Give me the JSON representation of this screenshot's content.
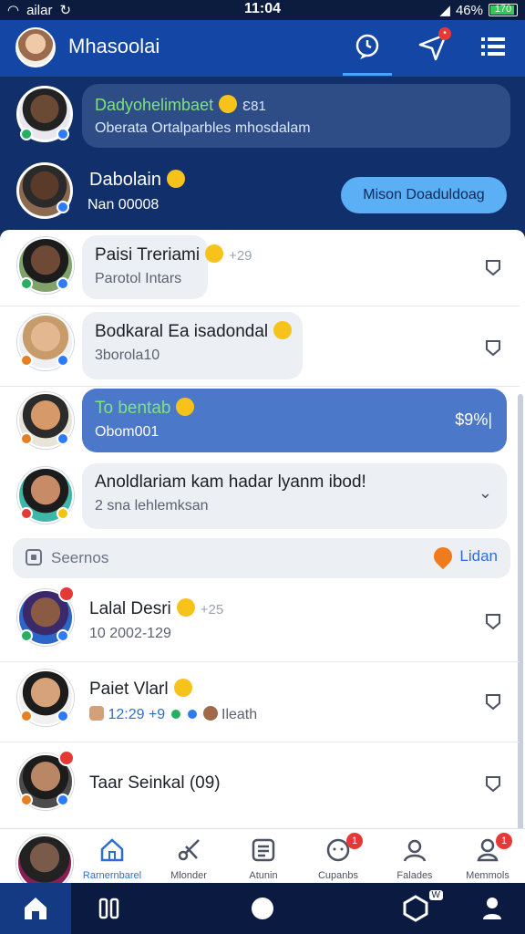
{
  "status": {
    "left": "ailar",
    "time": "11:04",
    "battery": "46%",
    "battery_box": "170"
  },
  "header": {
    "title": "Mhasoolai"
  },
  "top_rows": [
    {
      "name": "Dadyohelimbaet",
      "meta": "Ɛ81",
      "sub": "Oberata Ortalparbles mhosdalam"
    },
    {
      "name": "Dabolain",
      "sub": "Nan 00008",
      "button": "Mison Doaduldoag"
    }
  ],
  "rows": [
    {
      "name": "Paisi Treriami",
      "meta": "+29",
      "sub": "Parotol Intars"
    },
    {
      "name": "Bodkaral Ea isadondal",
      "sub": "3borola10"
    },
    {
      "name": "To bentab",
      "sub": "Obom001",
      "value": "$9%|"
    },
    {
      "name": "Anoldlariam kam hadar lyanm ibod!",
      "sub": "2 sna lehlemksan"
    },
    {
      "name": "Lalal Desri",
      "meta": "+25",
      "sub": "10 2002-129"
    },
    {
      "name": "Paiet Vlarl",
      "sub": "12:29 +9",
      "tag": "Ileath"
    },
    {
      "name": "Taar Seinkal (09)"
    }
  ],
  "search": {
    "placeholder": "Seernos",
    "action": "Lidan"
  },
  "tabs": [
    {
      "label": "Rarnernbarel"
    },
    {
      "label": "Mlonder"
    },
    {
      "label": "Atunin"
    },
    {
      "label": "Cupanbs",
      "badge": "1"
    },
    {
      "label": "Falades"
    },
    {
      "label": "Memmols",
      "badge": "1"
    }
  ],
  "nav_badge": "W"
}
